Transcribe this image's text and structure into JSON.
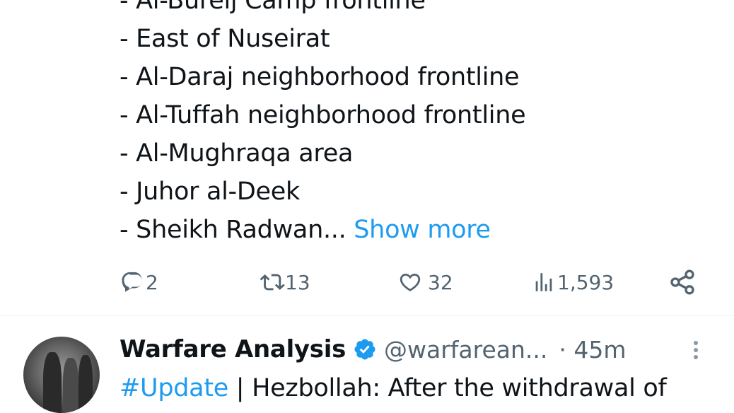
{
  "tweet1": {
    "lines": [
      "- Al-Bureij Camp frontline",
      "- East of Nuseirat",
      "- Al-Daraj neighborhood frontline",
      "- Al-Tuffah neighborhood frontline",
      "- Al-Mughraqa area",
      "- Juhor al-Deek",
      "- Sheikh Radwan..."
    ],
    "show_more": "Show more",
    "actions": {
      "replies": "2",
      "reposts": "13",
      "likes": "32",
      "views": "1,593"
    }
  },
  "tweet2": {
    "author_name": "Warfare Analysis",
    "handle": "@warfarean...",
    "time": "· 45m",
    "hashtag": "#Update",
    "text": " | Hezbollah: After the withdrawal of"
  },
  "colors": {
    "accent": "#1d9bf0",
    "muted": "#536471",
    "divider": "#eff3f4"
  },
  "icons": {
    "reply": "reply-icon",
    "repost": "repost-icon",
    "like": "heart-icon",
    "views": "views-icon",
    "share": "share-icon",
    "verified": "verified-badge-icon",
    "more": "more-options-icon"
  }
}
